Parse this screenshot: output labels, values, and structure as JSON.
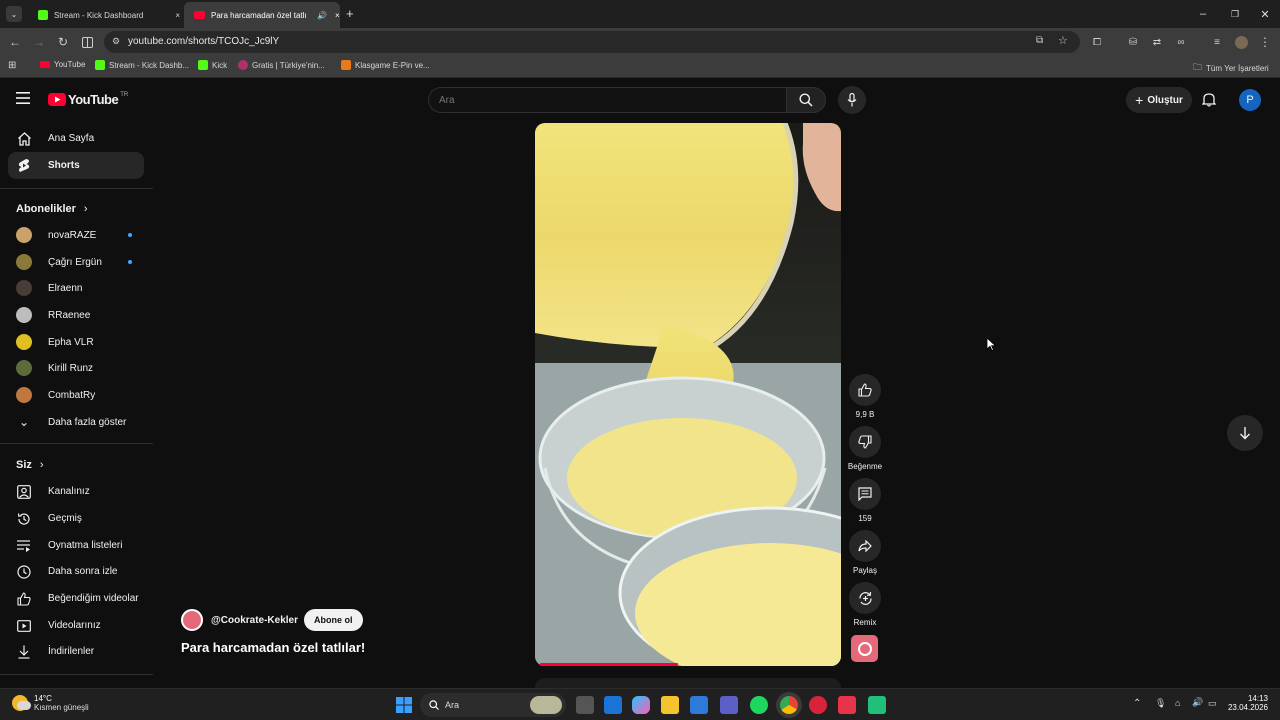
{
  "browser": {
    "tabs": [
      {
        "title": "Stream - Kick Dashboard",
        "active": false
      },
      {
        "title": "Para harcamadan özel tatlı",
        "active": true
      }
    ],
    "url": "youtube.com/shorts/TCOJc_Jc9lY",
    "bookmarks": [
      "YouTube",
      "Stream - Kick Dashb...",
      "Kick",
      "Gratis | Türkiye'nin...",
      "Klasgame E-Pin ve..."
    ],
    "all_bookmarks": "Tüm Yer İşaretleri"
  },
  "youtube": {
    "logo": "YouTube",
    "region": "TR",
    "search_placeholder": "Ara",
    "create_label": "Oluştur",
    "avatar_letter": "P"
  },
  "sidebar": {
    "main": [
      {
        "label": "Ana Sayfa",
        "icon": "home-icon"
      },
      {
        "label": "Shorts",
        "icon": "shorts-icon",
        "active": true
      }
    ],
    "subs_title": "Abonelikler",
    "subscriptions": [
      {
        "label": "novaRAZE",
        "new": true,
        "color": "#c9a36b"
      },
      {
        "label": "Çağrı Ergün",
        "new": true,
        "color": "#8a7a3a"
      },
      {
        "label": "Elraenn",
        "new": false,
        "color": "#4a3c36"
      },
      {
        "label": "RRaenee",
        "new": false,
        "color": "#bdbdbd"
      },
      {
        "label": "Epha VLR",
        "new": false,
        "color": "#e0c020"
      },
      {
        "label": "Kirill Runz",
        "new": false,
        "color": "#5d6a3a"
      },
      {
        "label": "CombatRy",
        "new": false,
        "color": "#c07840"
      }
    ],
    "show_more": "Daha fazla göster",
    "you_title": "Siz",
    "you": [
      {
        "label": "Kanalınız",
        "icon": "channel-icon"
      },
      {
        "label": "Geçmiş",
        "icon": "history-icon"
      },
      {
        "label": "Oynatma listeleri",
        "icon": "playlist-icon"
      },
      {
        "label": "Daha sonra izle",
        "icon": "watch-later-icon"
      },
      {
        "label": "Beğendiğim videolar",
        "icon": "like-icon"
      },
      {
        "label": "Videolarınız",
        "icon": "video-icon"
      },
      {
        "label": "İndirilenler",
        "icon": "download-icon"
      }
    ]
  },
  "short": {
    "channel": "@Cookrate-Kekler",
    "subscribe": "Abone ol",
    "title": "Para harcamadan özel tatlılar!",
    "likes": "9,9 B",
    "dislike_label": "Beğenme",
    "comments": "159",
    "share_label": "Paylaş",
    "remix_label": "Remix",
    "progress": 0.45
  },
  "taskbar": {
    "temp": "14°C",
    "weather": "Kısmen güneşli",
    "search": "Ara",
    "time": "14:13",
    "date": "23.04.2026"
  }
}
